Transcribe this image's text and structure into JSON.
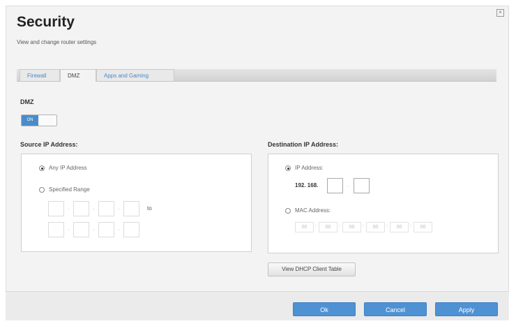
{
  "header": {
    "title": "Security",
    "subtitle": "View and change router settings"
  },
  "tabs": [
    {
      "label": "Firewall",
      "active": false
    },
    {
      "label": "DMZ",
      "active": true
    },
    {
      "label": "Apps and Gaming",
      "active": false
    }
  ],
  "dmz": {
    "label": "DMZ",
    "toggle_label": "ON",
    "toggle_state": "on"
  },
  "source": {
    "heading": "Source IP Address:",
    "any_label": "Any IP Address",
    "any_checked": true,
    "range_label": "Specified Range",
    "range_checked": false,
    "to_label": "to"
  },
  "destination": {
    "heading": "Destination IP Address:",
    "ip_label": "IP Address:",
    "ip_checked": true,
    "ip_prefix": "192. 168.",
    "mac_label": "MAC Address:",
    "mac_checked": false,
    "mac_values": [
      "00",
      "00",
      "00",
      "00",
      "00",
      "00"
    ],
    "mac_separator": ":",
    "dhcp_button_label": "View DHCP Client Table"
  },
  "footer": {
    "ok_label": "Ok",
    "cancel_label": "Cancel",
    "apply_label": "Apply"
  },
  "colors": {
    "accent": "#4f92d3",
    "tab_link": "#4a88c8"
  }
}
